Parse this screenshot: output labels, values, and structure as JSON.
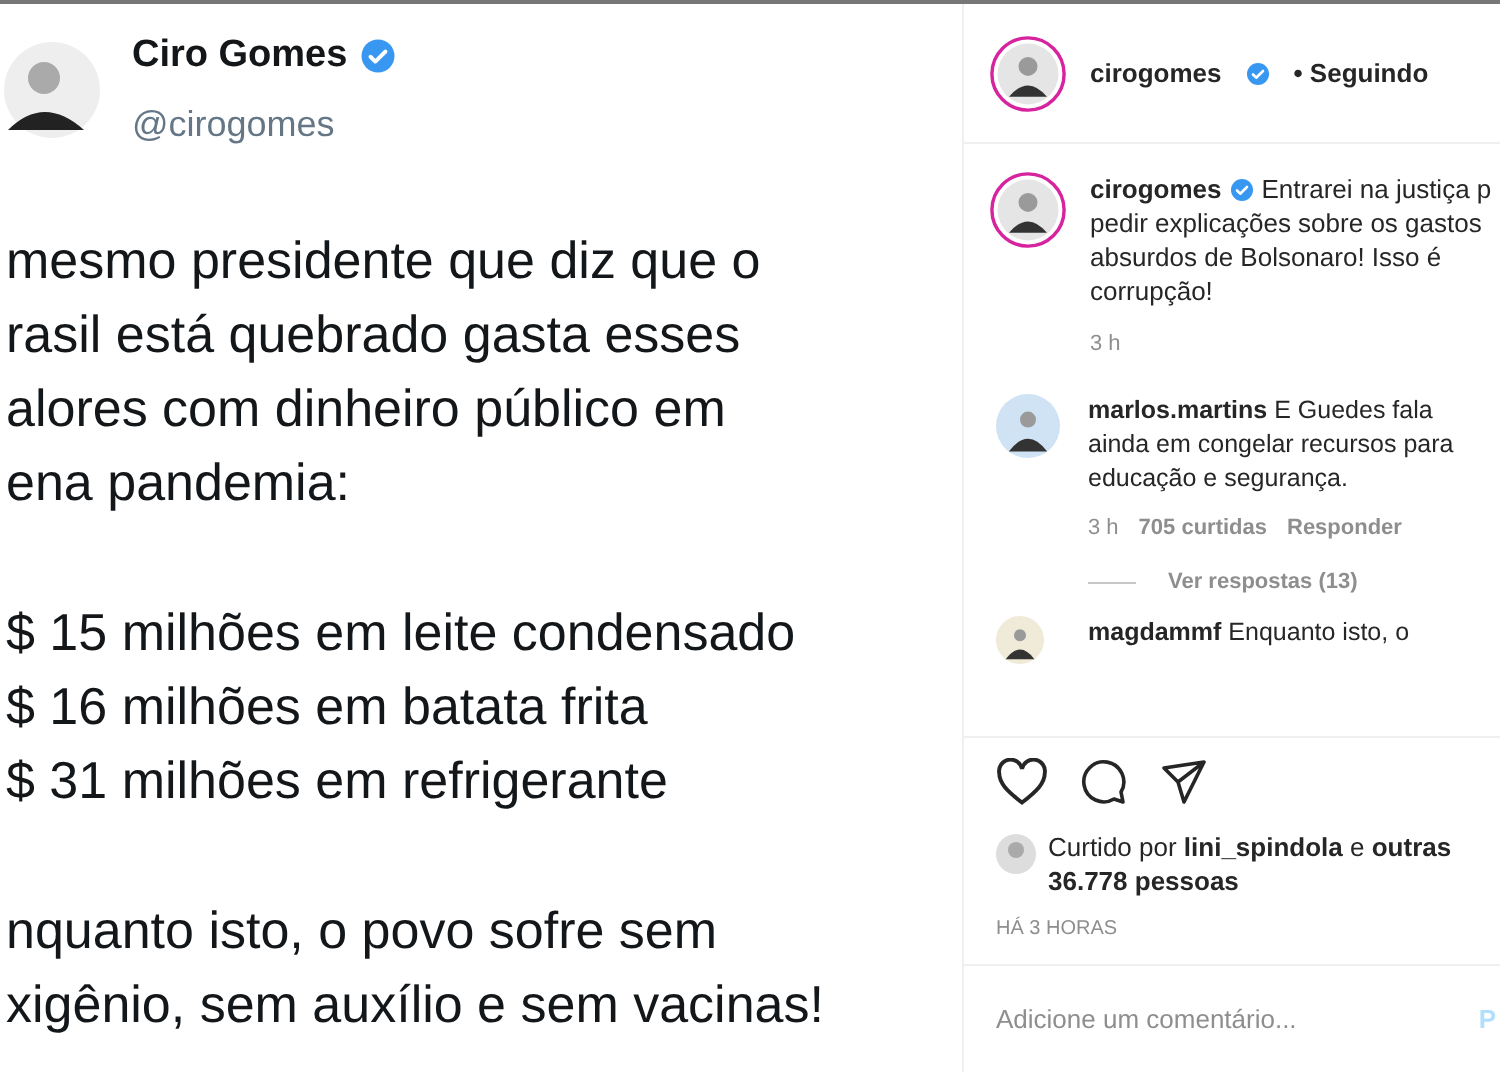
{
  "tweet": {
    "name": "Ciro Gomes",
    "verified": true,
    "handle": "@cirogomes",
    "paragraphs": [
      [
        "mesmo presidente que diz que o",
        "rasil está quebrado gasta esses",
        "alores com dinheiro público em",
        "ena pandemia:"
      ],
      [
        "$ 15 milhões em leite condensado",
        "$ 16 milhões em batata frita",
        "$ 31 milhões em refrigerante"
      ],
      [
        "nquanto isto, o povo sofre sem",
        "xigênio, sem auxílio e sem vacinas!"
      ]
    ]
  },
  "post": {
    "header": {
      "username": "cirogomes",
      "verified": true,
      "follow_status": "• Seguindo"
    },
    "caption": {
      "username": "cirogomes",
      "verified": true,
      "lines": [
        "Entrarei na justiça p",
        "pedir explicações sobre os gastos",
        "absurdos de Bolsonaro! Isso é",
        "corrupção!"
      ],
      "time": "3 h"
    },
    "comments": [
      {
        "username": "marlos.martins",
        "text": "E Guedes fala ainda em congelar recursos para educação e segurança.",
        "time": "3 h",
        "likes": "705 curtidas",
        "reply": "Responder",
        "view_replies": "Ver respostas (13)"
      },
      {
        "username": "magdammf",
        "text": "Enquanto isto, o"
      }
    ],
    "liked": false,
    "likes_text": "Curtido por **lini_spindola** e **outras 36.778 pessoas**",
    "timestamp": "HÁ 3 HORAS",
    "comment_input": {
      "placeholder": "Adicione um comentário...",
      "post_button": "P"
    }
  }
}
